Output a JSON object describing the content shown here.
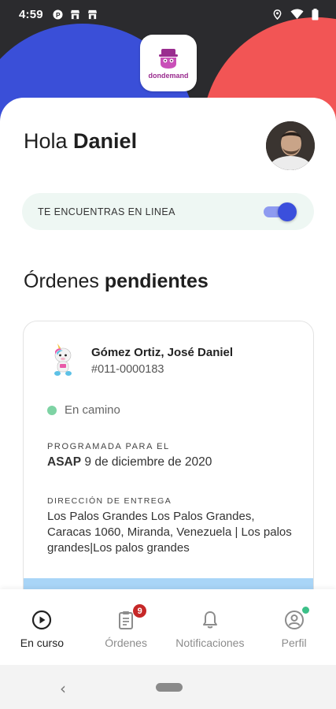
{
  "status_bar": {
    "time": "4:59",
    "left_icons": [
      "parking-app-icon",
      "store-icon",
      "store-icon"
    ],
    "right_icons": [
      "location-icon",
      "wifi-icon",
      "battery-icon"
    ]
  },
  "logo": {
    "text": "dondemand"
  },
  "greeting": {
    "prefix": "Hola",
    "name": "Daniel"
  },
  "online_status": {
    "label": "TE ENCUENTRAS EN LINEA",
    "enabled": true
  },
  "section": {
    "title_prefix": "Órdenes",
    "title_bold": "pendientes"
  },
  "order": {
    "customer_name": "Gómez Ortiz, José Daniel",
    "order_number": "#011-0000183",
    "status": "En camino",
    "scheduled_caption": "PROGRAMADA PARA EL",
    "scheduled_bold": "ASAP",
    "scheduled_date": "9 de diciembre de 2020",
    "address_caption": "DIRECCIÓN DE ENTREGA",
    "address": "Los Palos Grandes Los Palos Grandes, Caracas 1060, Miranda, Venezuela | Los palos grandes|Los palos grandes"
  },
  "bottom_nav": {
    "items": [
      {
        "label": "En curso",
        "icon": "play-circle-icon",
        "active": true
      },
      {
        "label": "Órdenes",
        "icon": "clipboard-icon",
        "badge": "9"
      },
      {
        "label": "Notificaciones",
        "icon": "bell-icon"
      },
      {
        "label": "Perfil",
        "icon": "user-circle-icon",
        "dot": true
      }
    ]
  },
  "colors": {
    "accent": "#3b4fdc",
    "hero_blue": "#3a4fd8",
    "hero_red": "#f25555",
    "hero_dark": "#2b2b2e",
    "online_bg": "#eef7f3",
    "status_green": "#7ed3a4",
    "badge_red": "#c62828"
  }
}
